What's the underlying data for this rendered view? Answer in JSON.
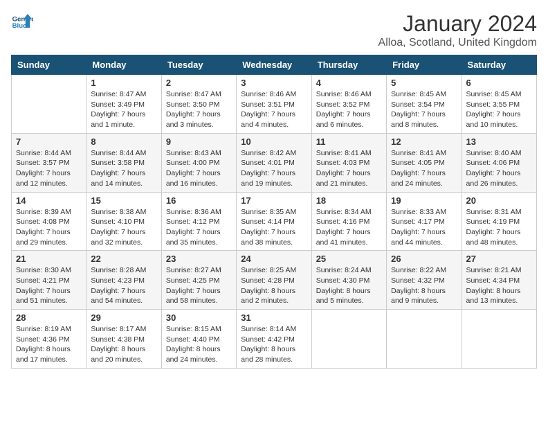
{
  "logo": {
    "text_general": "General",
    "text_blue": "Blue"
  },
  "header": {
    "title": "January 2024",
    "subtitle": "Alloa, Scotland, United Kingdom"
  },
  "weekdays": [
    "Sunday",
    "Monday",
    "Tuesday",
    "Wednesday",
    "Thursday",
    "Friday",
    "Saturday"
  ],
  "weeks": [
    [
      {
        "day": "",
        "info": ""
      },
      {
        "day": "1",
        "info": "Sunrise: 8:47 AM\nSunset: 3:49 PM\nDaylight: 7 hours\nand 1 minute."
      },
      {
        "day": "2",
        "info": "Sunrise: 8:47 AM\nSunset: 3:50 PM\nDaylight: 7 hours\nand 3 minutes."
      },
      {
        "day": "3",
        "info": "Sunrise: 8:46 AM\nSunset: 3:51 PM\nDaylight: 7 hours\nand 4 minutes."
      },
      {
        "day": "4",
        "info": "Sunrise: 8:46 AM\nSunset: 3:52 PM\nDaylight: 7 hours\nand 6 minutes."
      },
      {
        "day": "5",
        "info": "Sunrise: 8:45 AM\nSunset: 3:54 PM\nDaylight: 7 hours\nand 8 minutes."
      },
      {
        "day": "6",
        "info": "Sunrise: 8:45 AM\nSunset: 3:55 PM\nDaylight: 7 hours\nand 10 minutes."
      }
    ],
    [
      {
        "day": "7",
        "info": "Sunrise: 8:44 AM\nSunset: 3:57 PM\nDaylight: 7 hours\nand 12 minutes."
      },
      {
        "day": "8",
        "info": "Sunrise: 8:44 AM\nSunset: 3:58 PM\nDaylight: 7 hours\nand 14 minutes."
      },
      {
        "day": "9",
        "info": "Sunrise: 8:43 AM\nSunset: 4:00 PM\nDaylight: 7 hours\nand 16 minutes."
      },
      {
        "day": "10",
        "info": "Sunrise: 8:42 AM\nSunset: 4:01 PM\nDaylight: 7 hours\nand 19 minutes."
      },
      {
        "day": "11",
        "info": "Sunrise: 8:41 AM\nSunset: 4:03 PM\nDaylight: 7 hours\nand 21 minutes."
      },
      {
        "day": "12",
        "info": "Sunrise: 8:41 AM\nSunset: 4:05 PM\nDaylight: 7 hours\nand 24 minutes."
      },
      {
        "day": "13",
        "info": "Sunrise: 8:40 AM\nSunset: 4:06 PM\nDaylight: 7 hours\nand 26 minutes."
      }
    ],
    [
      {
        "day": "14",
        "info": "Sunrise: 8:39 AM\nSunset: 4:08 PM\nDaylight: 7 hours\nand 29 minutes."
      },
      {
        "day": "15",
        "info": "Sunrise: 8:38 AM\nSunset: 4:10 PM\nDaylight: 7 hours\nand 32 minutes."
      },
      {
        "day": "16",
        "info": "Sunrise: 8:36 AM\nSunset: 4:12 PM\nDaylight: 7 hours\nand 35 minutes."
      },
      {
        "day": "17",
        "info": "Sunrise: 8:35 AM\nSunset: 4:14 PM\nDaylight: 7 hours\nand 38 minutes."
      },
      {
        "day": "18",
        "info": "Sunrise: 8:34 AM\nSunset: 4:16 PM\nDaylight: 7 hours\nand 41 minutes."
      },
      {
        "day": "19",
        "info": "Sunrise: 8:33 AM\nSunset: 4:17 PM\nDaylight: 7 hours\nand 44 minutes."
      },
      {
        "day": "20",
        "info": "Sunrise: 8:31 AM\nSunset: 4:19 PM\nDaylight: 7 hours\nand 48 minutes."
      }
    ],
    [
      {
        "day": "21",
        "info": "Sunrise: 8:30 AM\nSunset: 4:21 PM\nDaylight: 7 hours\nand 51 minutes."
      },
      {
        "day": "22",
        "info": "Sunrise: 8:28 AM\nSunset: 4:23 PM\nDaylight: 7 hours\nand 54 minutes."
      },
      {
        "day": "23",
        "info": "Sunrise: 8:27 AM\nSunset: 4:25 PM\nDaylight: 7 hours\nand 58 minutes."
      },
      {
        "day": "24",
        "info": "Sunrise: 8:25 AM\nSunset: 4:28 PM\nDaylight: 8 hours\nand 2 minutes."
      },
      {
        "day": "25",
        "info": "Sunrise: 8:24 AM\nSunset: 4:30 PM\nDaylight: 8 hours\nand 5 minutes."
      },
      {
        "day": "26",
        "info": "Sunrise: 8:22 AM\nSunset: 4:32 PM\nDaylight: 8 hours\nand 9 minutes."
      },
      {
        "day": "27",
        "info": "Sunrise: 8:21 AM\nSunset: 4:34 PM\nDaylight: 8 hours\nand 13 minutes."
      }
    ],
    [
      {
        "day": "28",
        "info": "Sunrise: 8:19 AM\nSunset: 4:36 PM\nDaylight: 8 hours\nand 17 minutes."
      },
      {
        "day": "29",
        "info": "Sunrise: 8:17 AM\nSunset: 4:38 PM\nDaylight: 8 hours\nand 20 minutes."
      },
      {
        "day": "30",
        "info": "Sunrise: 8:15 AM\nSunset: 4:40 PM\nDaylight: 8 hours\nand 24 minutes."
      },
      {
        "day": "31",
        "info": "Sunrise: 8:14 AM\nSunset: 4:42 PM\nDaylight: 8 hours\nand 28 minutes."
      },
      {
        "day": "",
        "info": ""
      },
      {
        "day": "",
        "info": ""
      },
      {
        "day": "",
        "info": ""
      }
    ]
  ]
}
